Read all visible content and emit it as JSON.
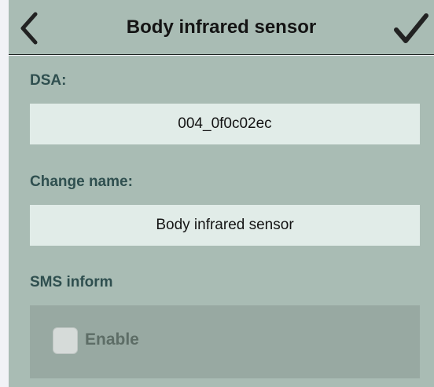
{
  "header": {
    "title": "Body infrared sensor",
    "back_icon": "chevron-left-icon",
    "confirm_icon": "checkmark-icon"
  },
  "form": {
    "dsa_label": "DSA:",
    "dsa_value": "004_0f0c02ec",
    "name_label": "Change name:",
    "name_value": "Body infrared sensor",
    "sms_label": "SMS inform",
    "sms_enable_label": "Enable",
    "sms_enabled": false
  },
  "colors": {
    "background": "#a9bcb4",
    "field": "#e1ece8",
    "label": "#2f4f4f",
    "disabled_panel": "#98a9a2"
  }
}
